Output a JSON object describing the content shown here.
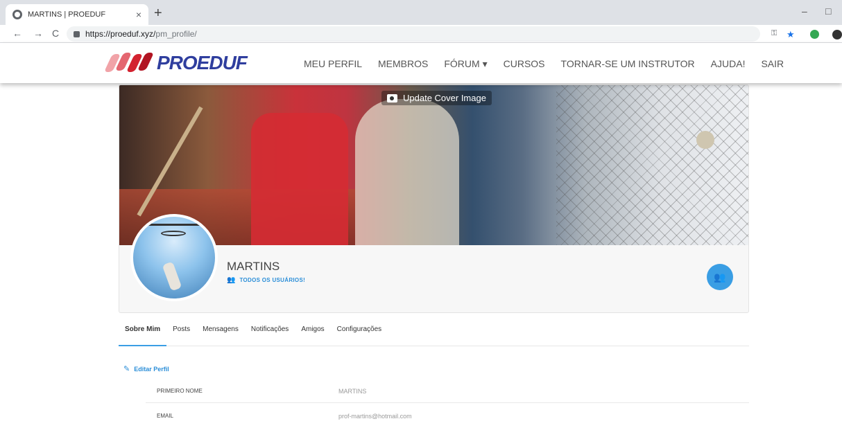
{
  "browser": {
    "tab_title": "MARTINS | PROEDUF",
    "tab_close": "×",
    "new_tab": "+",
    "url_host": "https://proeduf.xyz/",
    "url_path": "pm_profile/",
    "back": "←",
    "forward": "→",
    "reload": "C",
    "minimize": "–",
    "maximize": "□"
  },
  "site": {
    "logo_text": "PROEDUF",
    "nav": [
      "MEU PERFIL",
      "MEMBROS",
      "FÓRUM ▾",
      "CURSOS",
      "TORNAR-SE UM INSTRUTOR",
      "AJUDA!",
      "SAIR"
    ]
  },
  "profile": {
    "update_cover_label": "Update Cover Image",
    "name": "MARTINS",
    "group_label": "TODOS OS USUÁRIOS!"
  },
  "tabs": [
    "Sobre Mim",
    "Posts",
    "Mensagens",
    "Notificações",
    "Amigos",
    "Configurações"
  ],
  "edit_label": "Editar Perfil",
  "fields": [
    {
      "label": "PRIMEIRO NOME",
      "value": "MARTINS"
    },
    {
      "label": "EMAIL",
      "value": "prof-martins@hotmail.com"
    }
  ],
  "colors": {
    "accent": "#3a9ee4",
    "logo": "#2f3e9e"
  }
}
